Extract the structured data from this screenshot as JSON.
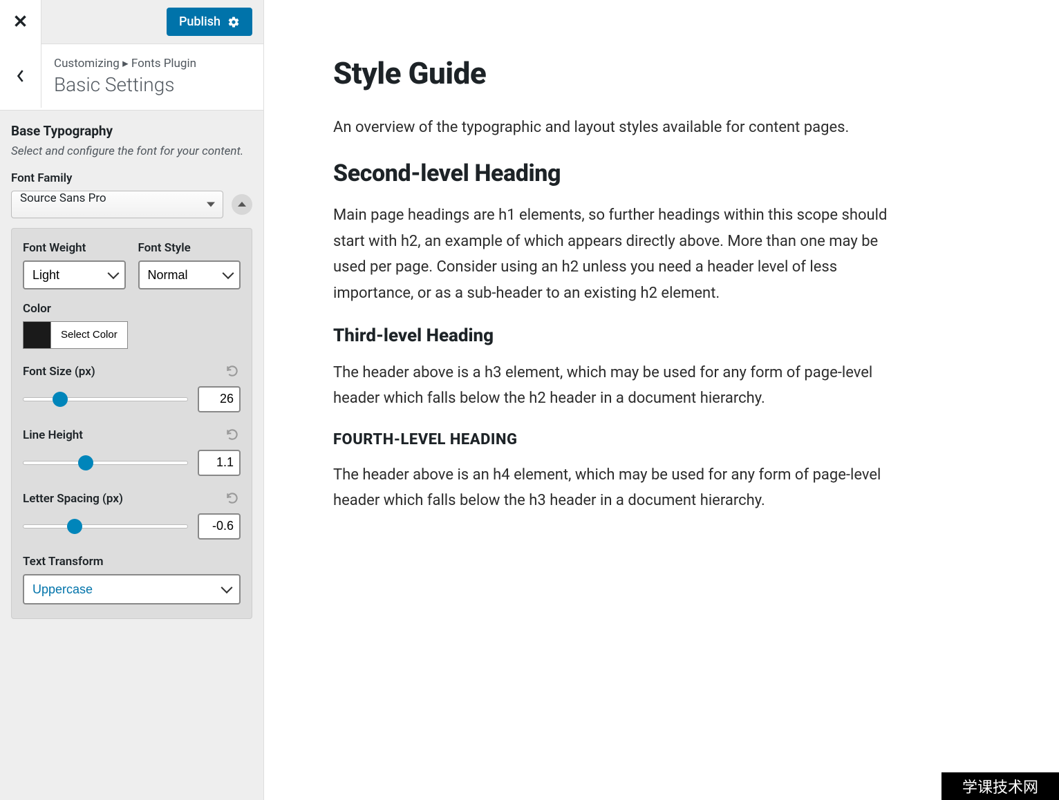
{
  "topbar": {
    "close_icon": "close-icon",
    "publish_label": "Publish",
    "settings_icon": "gear-icon"
  },
  "breadcrumb": {
    "prefix": "Customizing",
    "separator": "▸",
    "section": "Fonts Plugin",
    "title": "Basic Settings"
  },
  "panel": {
    "section_title": "Base Typography",
    "section_desc": "Select and configure the font for your content.",
    "font_family_label": "Font Family",
    "font_family_value": "Source Sans Pro",
    "font_weight_label": "Font Weight",
    "font_weight_value": "Light",
    "font_style_label": "Font Style",
    "font_style_value": "Normal",
    "color_label": "Color",
    "color_button": "Select Color",
    "color_value": "#1a1a1a",
    "font_size_label": "Font Size (px)",
    "font_size_value": "26",
    "line_height_label": "Line Height",
    "line_height_value": "1.1",
    "letter_spacing_label": "Letter Spacing (px)",
    "letter_spacing_value": "-0.6",
    "text_transform_label": "Text Transform",
    "text_transform_value": "Uppercase"
  },
  "preview": {
    "h1": "Style Guide",
    "p1": "An overview of the typographic and layout styles available for content pages.",
    "h2": "Second-level Heading",
    "p2": "Main page headings are h1 elements, so further headings within this scope should start with h2, an example of which appears directly above. More than one may be used per page. Consider using an h2 unless you need a header level of less importance, or as a sub-header to an existing h2 element.",
    "h3": "Third-level Heading",
    "p3": "The header above is a h3 element, which may be used for any form of page-level header which falls below the h2 header in a document hierarchy.",
    "h4": "FOURTH-LEVEL HEADING",
    "p4": "The header above is an h4 element, which may be used for any form of page-level header which falls below the h3 header in a document hierarchy."
  },
  "watermark": "学课技术网"
}
